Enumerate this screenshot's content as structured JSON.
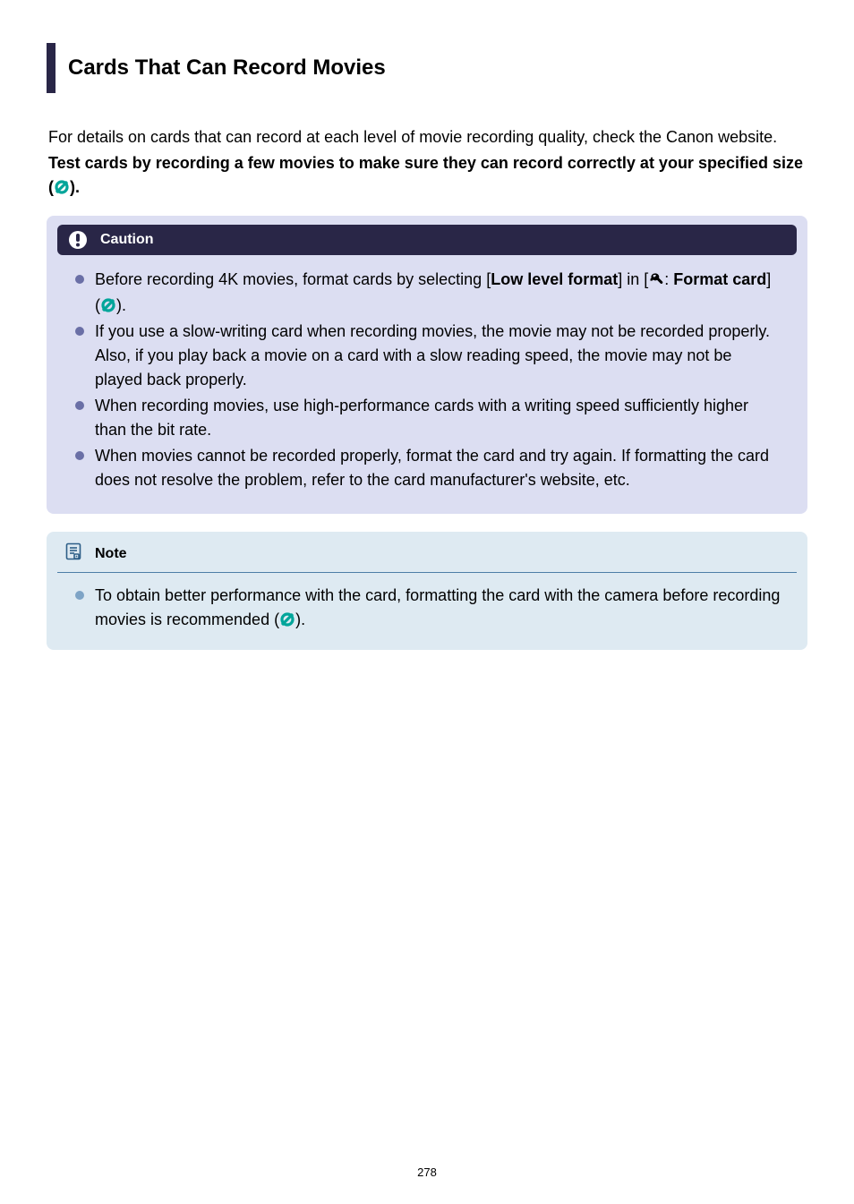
{
  "title": "Cards That Can Record Movies",
  "intro_text": "For details on cards that can record at each level of movie recording quality, check the Canon website.",
  "intro_bold_pre": "Test cards by recording a few movies to make sure they can record correctly at your specified size (",
  "intro_bold_post": ").",
  "caution": {
    "label": "Caution",
    "items": [
      {
        "pre": "Before recording 4K movies, format cards by selecting [",
        "bold1": "Low level format",
        "mid1": "] in [",
        "wrench": true,
        "mid2": ": ",
        "bold2": "Format card",
        "post_pre": "] (",
        "post_post": ")."
      },
      {
        "text": "If you use a slow-writing card when recording movies, the movie may not be recorded properly. Also, if you play back a movie on a card with a slow reading speed, the movie may not be played back properly."
      },
      {
        "text": "When recording movies, use high-performance cards with a writing speed sufficiently higher than the bit rate."
      },
      {
        "text": "When movies cannot be recorded properly, format the card and try again. If formatting the card does not resolve the problem, refer to the card manufacturer's website, etc."
      }
    ]
  },
  "note": {
    "label": "Note",
    "item_pre": "To obtain better performance with the card, formatting the card with the camera before recording movies is recommended (",
    "item_post": ")."
  },
  "page_number": "278"
}
